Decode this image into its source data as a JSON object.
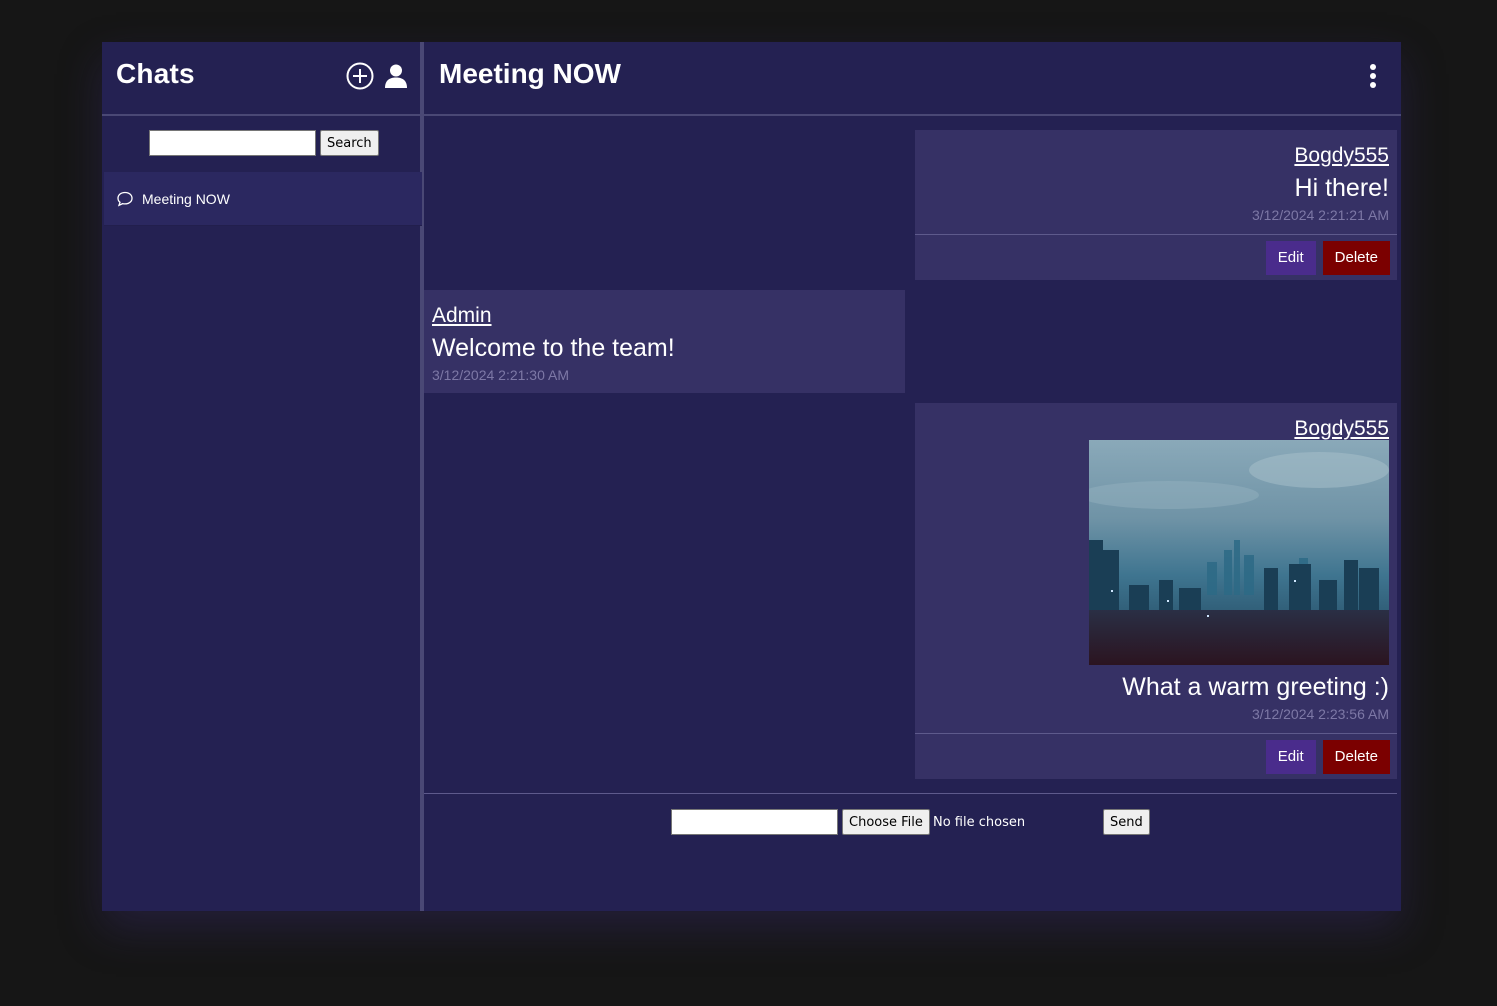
{
  "sidebar": {
    "title": "Chats",
    "search": {
      "value": "",
      "button_label": "Search"
    },
    "chats": [
      {
        "label": "Meeting NOW"
      }
    ]
  },
  "main": {
    "title": "Meeting NOW",
    "messages": [
      {
        "author": "Bogdy555",
        "text": "Hi there!",
        "time": "3/12/2024 2:21:21 AM",
        "own": true,
        "edit_label": "Edit",
        "delete_label": "Delete"
      },
      {
        "author": "Admin",
        "text": "Welcome to the team!",
        "time": "3/12/2024 2:21:30 AM",
        "own": false
      },
      {
        "author": "Bogdy555",
        "text": "What a warm greeting :)",
        "time": "3/12/2024 2:23:56 AM",
        "own": true,
        "has_image": true,
        "edit_label": "Edit",
        "delete_label": "Delete"
      }
    ],
    "composer": {
      "message_value": "",
      "choose_file_label": "Choose File",
      "file_status": "No file chosen",
      "send_label": "Send"
    }
  },
  "colors": {
    "background": "#161616",
    "panel": "#242152",
    "bubble": "#363165",
    "edit": "#4a2c8c",
    "delete": "#7b0000"
  }
}
